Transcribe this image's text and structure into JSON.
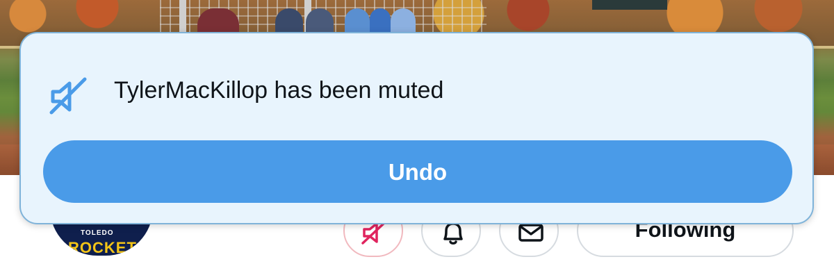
{
  "toast": {
    "message": "TylerMacKillop has been muted",
    "undo_label": "Undo",
    "icon": "muted-speaker-icon",
    "background_color": "#e8f4fd",
    "border_color": "#7fb3d9",
    "button_color": "#4a9be8"
  },
  "profile": {
    "avatar_text_top": "TOLEDO",
    "avatar_text_main": "ROCKETS",
    "actions": {
      "mute_icon": "muted-speaker-icon",
      "notifications_icon": "bell-icon",
      "message_icon": "envelope-icon",
      "following_label": "Following"
    }
  },
  "banner": {
    "description_icon": "header-photo"
  }
}
